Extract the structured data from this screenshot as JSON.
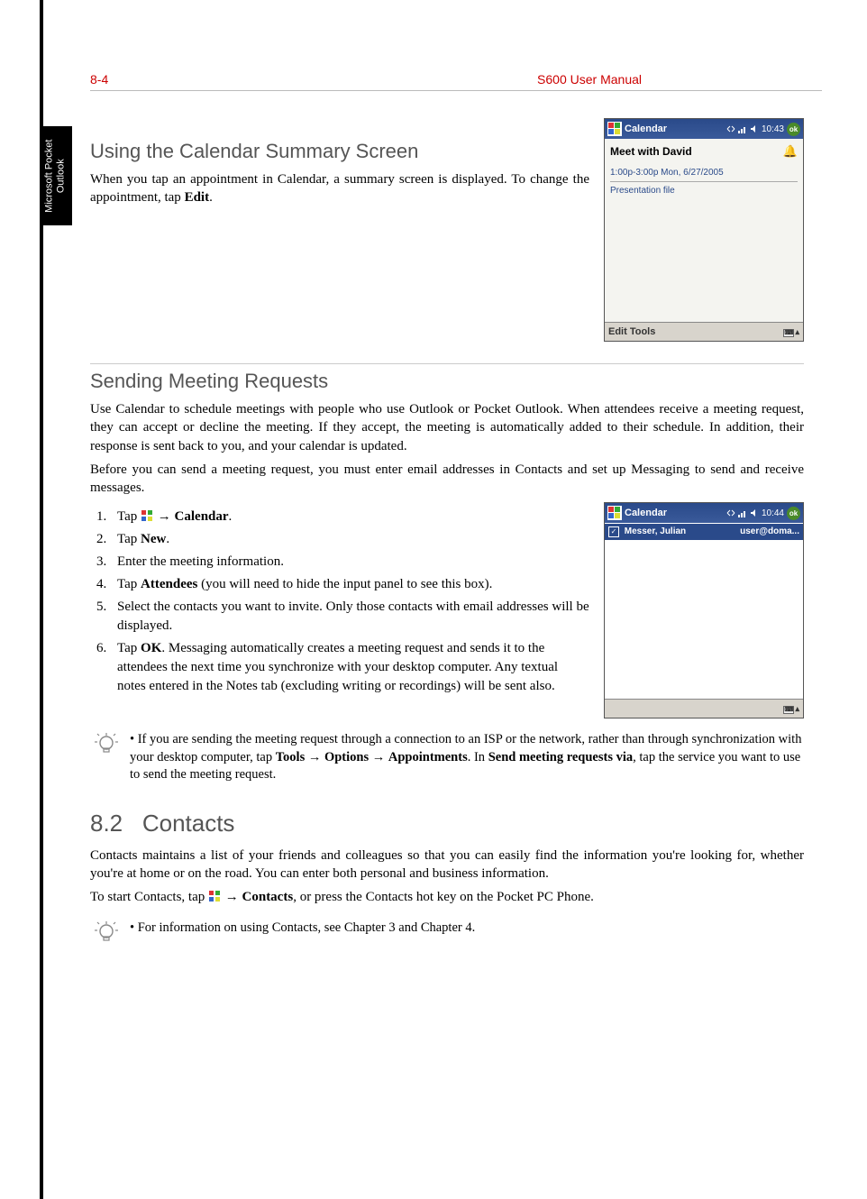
{
  "header": {
    "page_ref": "8-4",
    "doc_title": "S600 User Manual"
  },
  "side_tab": {
    "line1": "Microsoft Pocket",
    "line2": "Outlook"
  },
  "section1": {
    "heading": "Using the Calendar Summary Screen",
    "para_pre": "When you tap an appointment in Calendar, a summary screen is displayed. To change the appointment, tap ",
    "para_bold": "Edit",
    "para_post": "."
  },
  "ppc1": {
    "title": "Calendar",
    "time": "10:43",
    "ok": "ok",
    "meet_title": "Meet with David",
    "meet_time": "1:00p-3:00p Mon, 6/27/2005",
    "note": "Presentation file",
    "bottom_left": "Edit Tools"
  },
  "section2": {
    "heading": "Sending Meeting Requests",
    "para1": "Use Calendar to schedule meetings with people who use Outlook or Pocket Outlook. When attendees receive a meeting request, they can accept or decline the meeting. If they accept, the meeting is automatically added to their schedule. In addition, their response is sent back to you, and your calendar is updated.",
    "para2": "Before you can send a meeting request, you must enter email addresses in Contacts and set up Messaging to send and receive messages.",
    "steps": {
      "s1_pre": "Tap ",
      "s1_arrow": " → ",
      "s1_bold": "Calendar",
      "s1_post": ".",
      "s2_pre": "Tap ",
      "s2_bold": "New",
      "s2_post": ".",
      "s3": "Enter the meeting information.",
      "s4_pre": "Tap ",
      "s4_bold": "Attendees",
      "s4_post": " (you will need to hide the input panel to see this box).",
      "s5": "Select the contacts you want to invite. Only those contacts with email addresses will be displayed.",
      "s6_pre": "Tap ",
      "s6_bold": "OK",
      "s6_post": ". Messaging automatically creates a meeting request and sends it to the attendees the next time you synchronize with your desktop computer. Any textual notes entered in the Notes tab (excluding writing or recordings) will be sent also."
    }
  },
  "ppc2": {
    "title": "Calendar",
    "time": "10:44",
    "ok": "ok",
    "row_name": "Messer, Julian",
    "row_email": "user@doma..."
  },
  "tip1_pre": "If you are sending the meeting request through a connection to an ISP or the network, rather than through synchronization with your desktop computer, tap ",
  "tip1_b1": "Tools",
  "tip1_sep1": " → ",
  "tip1_b2": "Options",
  "tip1_sep2": " → ",
  "tip1_b3": "Appointments",
  "tip1_mid": ". In ",
  "tip1_b4": "Send meeting requests via",
  "tip1_post": ", tap the service you want to use to send the meeting request.",
  "chapter": {
    "number": "8.2",
    "title": "Contacts",
    "para1": "Contacts maintains a list of your friends and colleagues so that you can easily find the information you're looking for, whether you're at home or on the road. You can enter both personal and business information.",
    "para2_pre": "To start Contacts, tap ",
    "para2_arrow": " → ",
    "para2_bold": "Contacts",
    "para2_post": ", or press the Contacts hot key on the Pocket PC Phone."
  },
  "tip2": "For information on using Contacts, see Chapter 3 and Chapter 4."
}
